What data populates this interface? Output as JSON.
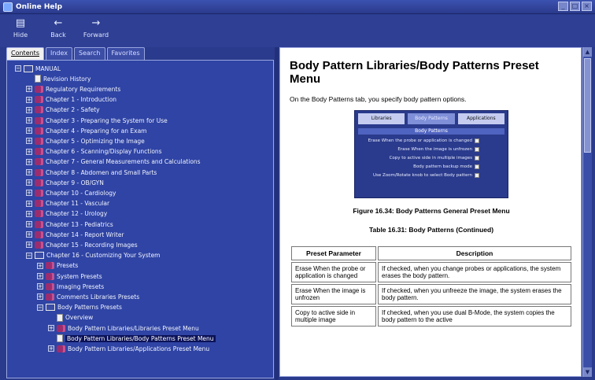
{
  "window": {
    "title": "Online Help",
    "controls": [
      "_",
      "□",
      "×"
    ]
  },
  "toolbar": {
    "buttons": [
      {
        "label": "Hide",
        "icon": "hide-icon"
      },
      {
        "label": "Back",
        "icon": "back-arrow-icon"
      },
      {
        "label": "Forward",
        "icon": "forward-arrow-icon"
      }
    ]
  },
  "tabs": [
    "Contents",
    "Index",
    "Search",
    "Favorites"
  ],
  "tree": [
    {
      "label": "MANUAL",
      "level": 0,
      "type": "book-open",
      "expander": "−"
    },
    {
      "label": "Revision History",
      "level": 1,
      "type": "page",
      "expander": ""
    },
    {
      "label": "Regulatory Requirements",
      "level": 1,
      "type": "book",
      "expander": "+"
    },
    {
      "label": "Chapter 1 - Introduction",
      "level": 1,
      "type": "book",
      "expander": "+"
    },
    {
      "label": "Chapter 2 - Safety",
      "level": 1,
      "type": "book",
      "expander": "+"
    },
    {
      "label": "Chapter 3 - Preparing the System for Use",
      "level": 1,
      "type": "book",
      "expander": "+"
    },
    {
      "label": "Chapter 4 - Preparing for an Exam",
      "level": 1,
      "type": "book",
      "expander": "+"
    },
    {
      "label": "Chapter 5 - Optimizing the Image",
      "level": 1,
      "type": "book",
      "expander": "+"
    },
    {
      "label": "Chapter 6 - Scanning/Display Functions",
      "level": 1,
      "type": "book",
      "expander": "+"
    },
    {
      "label": "Chapter 7 - General Measurements and Calculations",
      "level": 1,
      "type": "book",
      "expander": "+"
    },
    {
      "label": "Chapter 8 - Abdomen and Small Parts",
      "level": 1,
      "type": "book",
      "expander": "+"
    },
    {
      "label": "Chapter 9 - OB/GYN",
      "level": 1,
      "type": "book",
      "expander": "+"
    },
    {
      "label": "Chapter 10 - Cardiology",
      "level": 1,
      "type": "book",
      "expander": "+"
    },
    {
      "label": "Chapter 11 - Vascular",
      "level": 1,
      "type": "book",
      "expander": "+"
    },
    {
      "label": "Chapter 12 - Urology",
      "level": 1,
      "type": "book",
      "expander": "+"
    },
    {
      "label": "Chapter 13 - Pediatrics",
      "level": 1,
      "type": "book",
      "expander": "+"
    },
    {
      "label": "Chapter 14 - Report Writer",
      "level": 1,
      "type": "book",
      "expander": "+"
    },
    {
      "label": "Chapter 15 - Recording Images",
      "level": 1,
      "type": "book",
      "expander": "+"
    },
    {
      "label": "Chapter 16 - Customizing Your System",
      "level": 1,
      "type": "book-open",
      "expander": "−"
    },
    {
      "label": "Presets",
      "level": 2,
      "type": "book",
      "expander": "+"
    },
    {
      "label": "System Presets",
      "level": 2,
      "type": "book",
      "expander": "+"
    },
    {
      "label": "Imaging Presets",
      "level": 2,
      "type": "book",
      "expander": "+"
    },
    {
      "label": "Comments Libraries Presets",
      "level": 2,
      "type": "book",
      "expander": "+"
    },
    {
      "label": "Body Patterns Presets",
      "level": 2,
      "type": "book-open",
      "expander": "−"
    },
    {
      "label": "Overview",
      "level": 3,
      "type": "page",
      "expander": ""
    },
    {
      "label": "Body Pattern Libraries/Libraries Preset Menu",
      "level": 3,
      "type": "book",
      "expander": "+"
    },
    {
      "label": "Body Pattern Libraries/Body Patterns Preset Menu",
      "level": 3,
      "type": "page",
      "expander": "",
      "selected": true
    },
    {
      "label": "Body Pattern Libraries/Applications Preset Menu",
      "level": 3,
      "type": "book",
      "expander": "+"
    }
  ],
  "page": {
    "title": "Body Pattern Libraries/Body Patterns Preset Menu",
    "intro": "On the Body Patterns tab, you specify body pattern options.",
    "figure": {
      "tabs": [
        "Libraries",
        "Body Patterns",
        "Applications"
      ],
      "header": "Body Patterns",
      "rows": [
        "Erase When the probe or application is changed",
        "Erase When the image is unfrozen",
        "Copy to active side in multiple images",
        "Body pattern backup mode",
        "Use Zoom/Rotate knob to select Body pattern"
      ]
    },
    "figure_caption": "Figure 16.34: Body Patterns General Preset Menu",
    "table_caption": "Table 16.31: Body Patterns (Continued)",
    "table": {
      "headers": [
        "Preset Parameter",
        "Description"
      ],
      "rows": [
        {
          "param": "Erase When the probe or application is changed",
          "desc": "If checked, when you change probes or applications, the system erases the body pattern."
        },
        {
          "param": "Erase When the image is unfrozen",
          "desc": "If checked, when you unfreeze the image, the system erases the body pattern."
        },
        {
          "param": "Copy to active side in multiple image",
          "desc": "If checked, when you use dual B-Mode, the system copies the body pattern to the active"
        }
      ]
    }
  },
  "colors": {
    "chrome": "#2a3a8c",
    "tree_bg": "#2f44a4",
    "selection": "#0b1258",
    "book": "#9b2d6e",
    "content_bg": "#ffffff"
  }
}
